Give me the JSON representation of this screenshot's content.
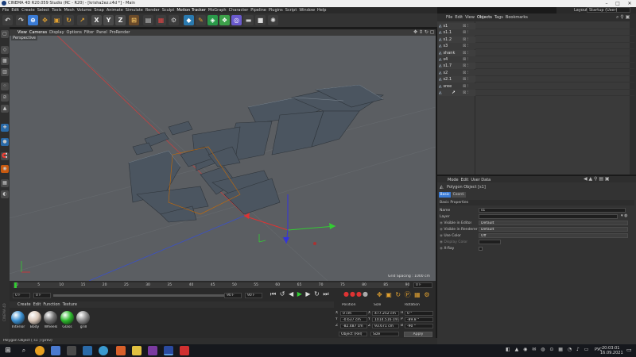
{
  "window": {
    "title": "CINEMA 4D R20.059 Studio (RC - R20) - [krisha2ez.c4d *] - Main"
  },
  "menubar": [
    "File",
    "Edit",
    "Create",
    "Select",
    "Tools",
    "Mesh",
    "Volume",
    "Snap",
    "Animate",
    "Simulate",
    "Render",
    "Sculpt",
    "Motion Tracker",
    "MoGraph",
    "Character",
    "Pipeline",
    "Plugins",
    "Script",
    "Window",
    "Help"
  ],
  "layout": {
    "label": "Layout:",
    "value": "Startup (User)"
  },
  "toolbar": {
    "x": "X",
    "y": "Y",
    "z": "Z"
  },
  "viewport": {
    "menu": [
      "View",
      "Cameras",
      "Display",
      "Options",
      "Filter",
      "Panel",
      "ProRender"
    ],
    "label": "Perspective",
    "grid_spacing": "Grid Spacing : 1000 cm"
  },
  "timeline": {
    "ticks": [
      "0",
      "5",
      "10",
      "15",
      "20",
      "25",
      "30",
      "35",
      "40",
      "45",
      "50",
      "55",
      "60",
      "65",
      "70",
      "75",
      "80",
      "85",
      "90"
    ],
    "frame_end": "0 F",
    "field_start": "0 F",
    "field_min": "0 F",
    "field_max": "90 F",
    "field_end": "90 F"
  },
  "materials": {
    "menu": [
      "Create",
      "Edit",
      "Function",
      "Texture"
    ],
    "items": [
      {
        "name": "Interior",
        "color": "#3a8fd0"
      },
      {
        "name": "Body",
        "color": "#d9c7b8"
      },
      {
        "name": "Wheels",
        "color": "#707070"
      },
      {
        "name": "Glass",
        "color": "#2bb72b"
      },
      {
        "name": "grill",
        "color": "#8a8a8a"
      }
    ]
  },
  "coords": {
    "headers": [
      "Position",
      "Size",
      "Rotation"
    ],
    "rows": [
      {
        "axis": "X",
        "pos": "0 cm",
        "saxis": "X",
        "size": "477.252 cm",
        "raxis": "H",
        "rot": "0 °"
      },
      {
        "axis": "Y",
        "pos": "-0.637 cm",
        "saxis": "Y",
        "size": "1014.516 cm",
        "raxis": "P",
        "rot": "-89.8 °"
      },
      {
        "axis": "Z",
        "pos": "-82.487 cm",
        "saxis": "Z",
        "size": "93.671 cm",
        "raxis": "B",
        "rot": "-90 °"
      }
    ],
    "mode": "Object (Rel)",
    "size_mode": "Size",
    "apply": "Apply"
  },
  "status": "Polygon Object [ s1 ] (prev)",
  "objects": {
    "menu": [
      "File",
      "Edit",
      "View",
      "Objects",
      "Tags",
      "Bookmarks"
    ],
    "items": [
      "s1",
      "s1.1",
      "s1.2",
      "s3",
      "shank",
      "s4",
      "s1.7",
      "s2",
      "s2.1",
      "sree",
      ""
    ]
  },
  "attributes": {
    "menu": [
      "Mode",
      "Edit",
      "User Data"
    ],
    "object_title": "Polygon Object [s1]",
    "tabs": [
      "Basic",
      "Coord."
    ],
    "section": "Basic Properties",
    "props": [
      {
        "label": "Name",
        "value": "s1"
      },
      {
        "label": "Layer",
        "value": ""
      },
      {
        "label": "Visible in Editor",
        "value": "Default"
      },
      {
        "label": "Visible in Renderer",
        "value": "Default"
      },
      {
        "label": "Use Color",
        "value": "Off"
      },
      {
        "label": "Display Color",
        "value": ""
      },
      {
        "label": "X-Ray",
        "value": ""
      }
    ]
  },
  "taskbar": {
    "lang": "РУС",
    "time": "20:03:01",
    "date": "16.09.2021"
  },
  "colors": {
    "selection": "#cc6b00",
    "accent": "#3a7bd5"
  }
}
